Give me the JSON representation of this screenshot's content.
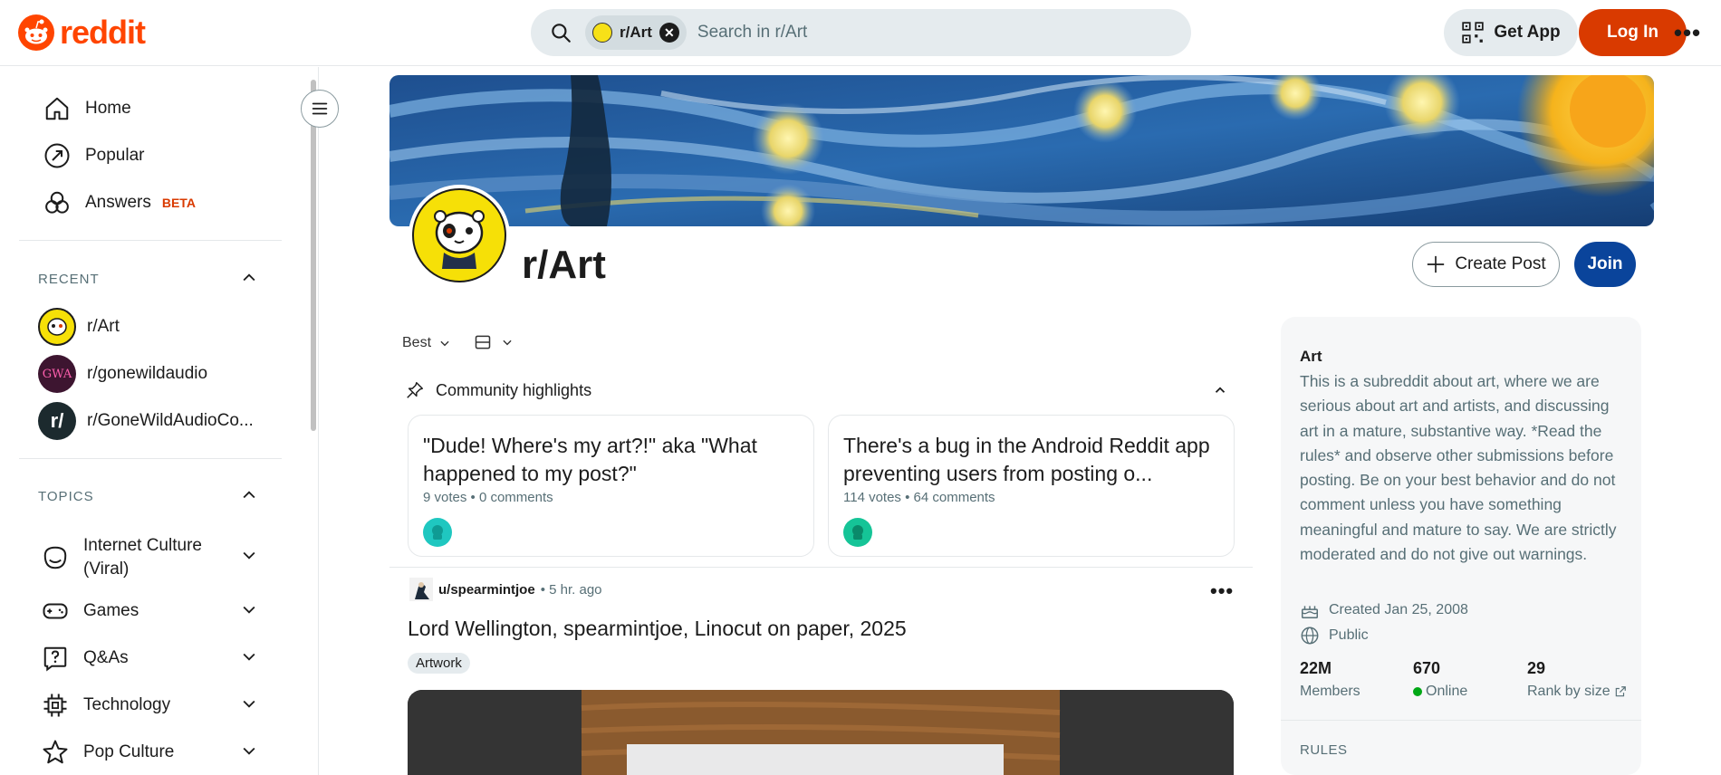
{
  "header": {
    "logo_text": "reddit",
    "search_chip": "r/Art",
    "search_placeholder": "Search in r/Art",
    "get_app_label": "Get App",
    "login_label": "Log In"
  },
  "sidebar": {
    "nav": [
      {
        "label": "Home",
        "icon": "home-icon"
      },
      {
        "label": "Popular",
        "icon": "popular-icon"
      },
      {
        "label": "Answers",
        "icon": "answers-icon",
        "badge": "BETA"
      }
    ],
    "recent_title": "RECENT",
    "recent": [
      {
        "label": "r/Art"
      },
      {
        "label": "r/gonewildaudio",
        "avatar_text": "GWA"
      },
      {
        "label": "r/GoneWildAudioCo...",
        "avatar_text": "r/"
      }
    ],
    "topics_title": "TOPICS",
    "topics": [
      {
        "label": "Internet Culture (Viral)",
        "icon": "smile-icon"
      },
      {
        "label": "Games",
        "icon": "gamepad-icon"
      },
      {
        "label": "Q&As",
        "icon": "question-icon"
      },
      {
        "label": "Technology",
        "icon": "chip-icon"
      },
      {
        "label": "Pop Culture",
        "icon": "star-icon"
      }
    ]
  },
  "community": {
    "name": "r/Art",
    "create_post_label": "Create Post",
    "join_label": "Join"
  },
  "feed": {
    "sort_label": "Best",
    "highlights_title": "Community highlights",
    "highlights": [
      {
        "title": "\"Dude! Where's my art?!\" aka \"What happened to my post?\"",
        "meta": "9 votes • 0 comments"
      },
      {
        "title": "There's a bug in the Android Reddit app preventing users from posting o...",
        "meta": "114 votes • 64 comments"
      }
    ],
    "post": {
      "user": "u/spearmintjoe",
      "time": "• 5 hr. ago",
      "title": "Lord Wellington, spearmintjoe, Linocut on paper, 2025",
      "flair": "Artwork"
    }
  },
  "about": {
    "title": "Art",
    "description": "This is a subreddit about art, where we are serious about art and artists, and discussing art in a mature, substantive way. *Read the rules* and observe other submissions before posting. Be on your best behavior and do not comment unless you have something meaningful and mature to say. We are strictly moderated and do not give out warnings.",
    "created": "Created Jan 25, 2008",
    "visibility": "Public",
    "stats": [
      {
        "value": "22M",
        "label": "Members"
      },
      {
        "value": "670",
        "label": "Online"
      },
      {
        "value": "29",
        "label": "Rank by size"
      }
    ],
    "rules_title": "RULES"
  },
  "colors": {
    "brand": "#ff4500",
    "login": "#d93a00",
    "join": "#0a449b",
    "online": "#01a816"
  }
}
